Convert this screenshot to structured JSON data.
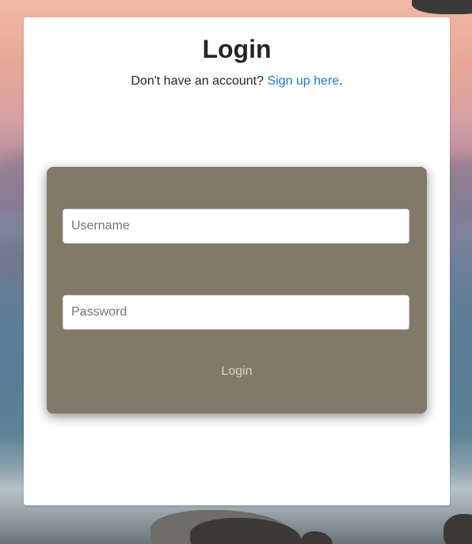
{
  "page": {
    "title": "Login",
    "signup_prompt": "Don't have an account? ",
    "signup_link": "Sign up here",
    "signup_suffix": "."
  },
  "form": {
    "username": {
      "placeholder": "Username",
      "value": ""
    },
    "password": {
      "placeholder": "Password",
      "value": ""
    },
    "submit_label": "Login",
    "panel_color": "#817a68"
  },
  "colors": {
    "link": "#1a7bd6",
    "title": "#212529"
  }
}
